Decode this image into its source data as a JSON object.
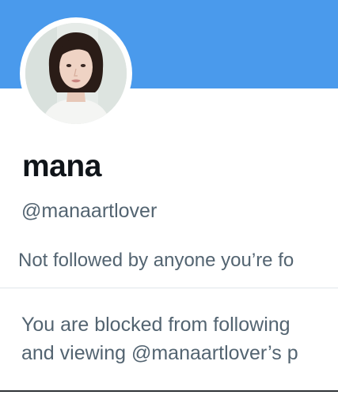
{
  "profile": {
    "display_name": "mana",
    "handle": "@manaartlover",
    "followers_you_know": "Not followed by anyone you’re fo",
    "blocked_line_1": "You are blocked from following",
    "blocked_line_2": "and viewing @manaartlover’s p"
  },
  "colors": {
    "banner": "#4a9aec",
    "secondary_text": "#536471",
    "primary_text": "#0f1419"
  }
}
